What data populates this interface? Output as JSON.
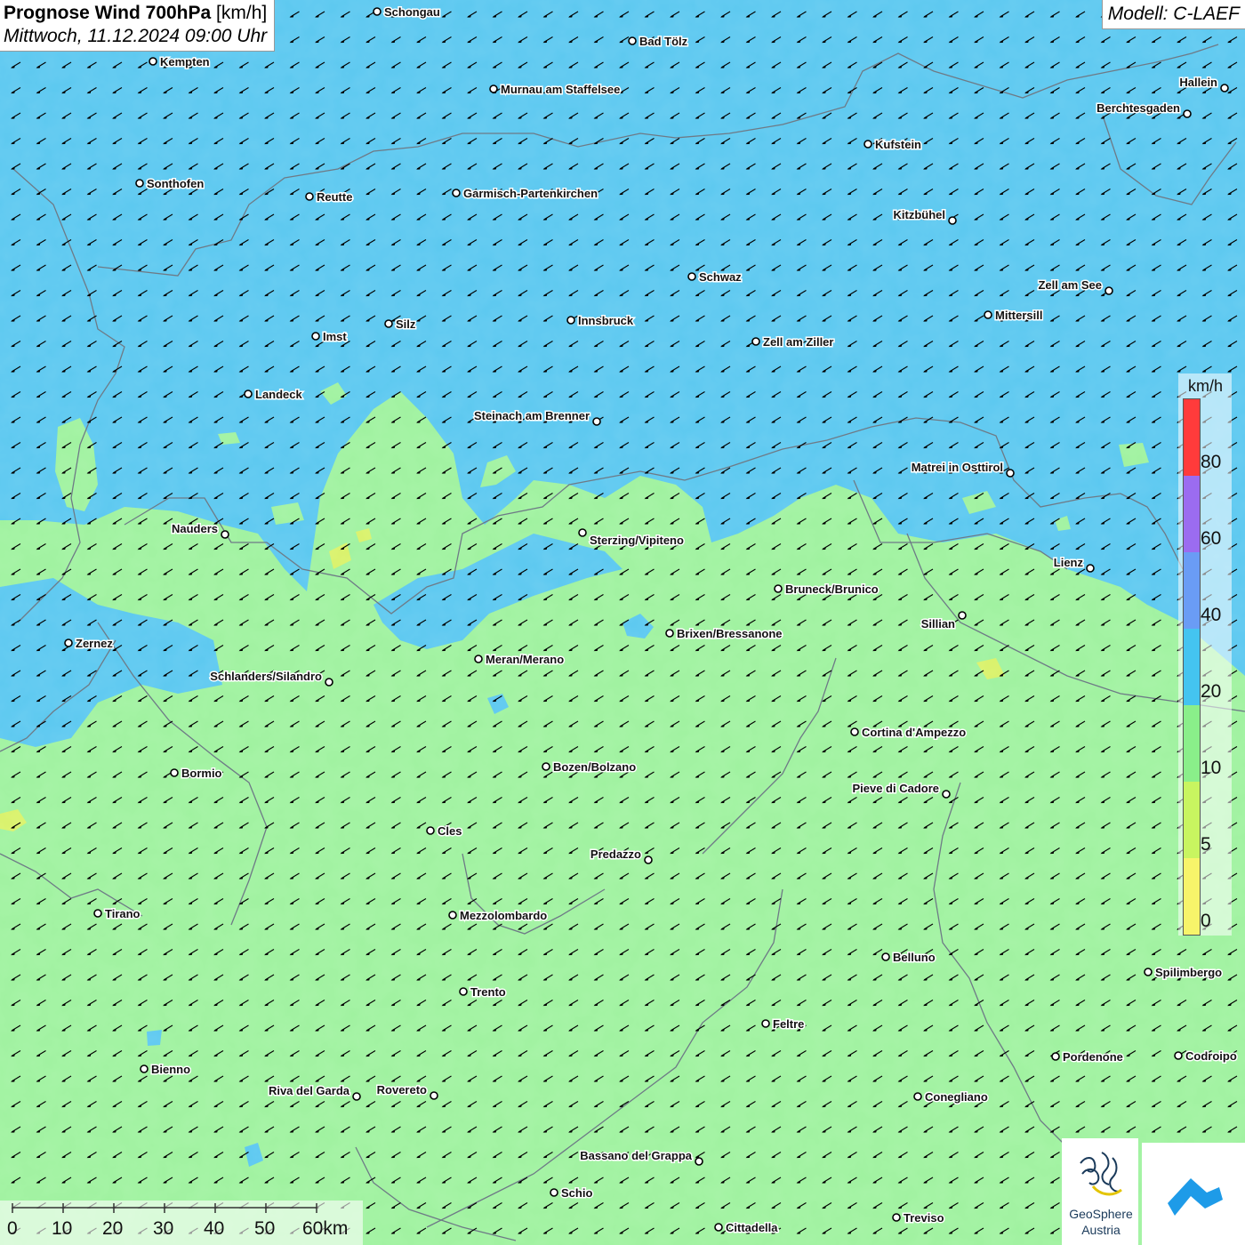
{
  "header": {
    "title_bold": "Prognose Wind 700hPa",
    "title_unit": "[km/h]",
    "datetime": "Mittwoch, 11.12.2024 09:00 Uhr",
    "model": "Modell: C-LAEF"
  },
  "colors": {
    "blue_zone": "#5bc8f0",
    "green_zone": "#9ff29f",
    "dark_blue_patch": "#55b8e6",
    "borders": "#6e7a86",
    "arrows": "#000000"
  },
  "map_layers": {
    "wind_arrow_direction": "from north-east (pointing south-west)"
  },
  "cities": [
    {
      "name": "Schongau"
    },
    {
      "name": "Bad Tölz"
    },
    {
      "name": "Kempten"
    },
    {
      "name": "Murnau am Staffelsee"
    },
    {
      "name": "Hallein"
    },
    {
      "name": "Berchtesgaden"
    },
    {
      "name": "Kufstein"
    },
    {
      "name": "Sonthofen"
    },
    {
      "name": "Reutte"
    },
    {
      "name": "Garmisch-Partenkirchen"
    },
    {
      "name": "Kitzbühel"
    },
    {
      "name": "Schwaz"
    },
    {
      "name": "Zell am See"
    },
    {
      "name": "Mittersill"
    },
    {
      "name": "Imst"
    },
    {
      "name": "Silz"
    },
    {
      "name": "Innsbruck"
    },
    {
      "name": "Zell am Ziller"
    },
    {
      "name": "Landeck"
    },
    {
      "name": "Steinach am Brenner"
    },
    {
      "name": "Matrei in Osttirol"
    },
    {
      "name": "Nauders"
    },
    {
      "name": "Sterzing/Vipiteno"
    },
    {
      "name": "Lienz"
    },
    {
      "name": "Bruneck/Brunico"
    },
    {
      "name": "Sillian"
    },
    {
      "name": "Zernez"
    },
    {
      "name": "Brixen/Bressanone"
    },
    {
      "name": "Meran/Merano"
    },
    {
      "name": "Schlanders/Silandro"
    },
    {
      "name": "Cortina d'Ampezzo"
    },
    {
      "name": "Bozen/Bolzano"
    },
    {
      "name": "Bormio"
    },
    {
      "name": "Pieve di Cadore"
    },
    {
      "name": "Cles"
    },
    {
      "name": "Predazzo"
    },
    {
      "name": "Tirano"
    },
    {
      "name": "Mezzolombardo"
    },
    {
      "name": "Belluno"
    },
    {
      "name": "Spilimbergo"
    },
    {
      "name": "Trento"
    },
    {
      "name": "Feltre"
    },
    {
      "name": "Pordenone"
    },
    {
      "name": "Codroipo"
    },
    {
      "name": "Bienno"
    },
    {
      "name": "Riva del Garda"
    },
    {
      "name": "Rovereto"
    },
    {
      "name": "Conegliano"
    },
    {
      "name": "Bassano del Grappa"
    },
    {
      "name": "Schio"
    },
    {
      "name": "Treviso"
    },
    {
      "name": "Cittadella"
    }
  ],
  "legend": {
    "unit": "km/h",
    "ticks": [
      "80",
      "60",
      "40",
      "20",
      "10",
      "5",
      "0"
    ],
    "colors": [
      "#ff3b3b",
      "#9b6cf0",
      "#6a9cf5",
      "#44c4f0",
      "#8aef8a",
      "#c8f560",
      "#f7f46a"
    ]
  },
  "scale_bar": {
    "labels": [
      "0",
      "10",
      "20",
      "30",
      "40",
      "50",
      "60km"
    ]
  },
  "logos": {
    "geosphere_line1": "GeoSphere",
    "geosphere_line2": "Austria"
  }
}
